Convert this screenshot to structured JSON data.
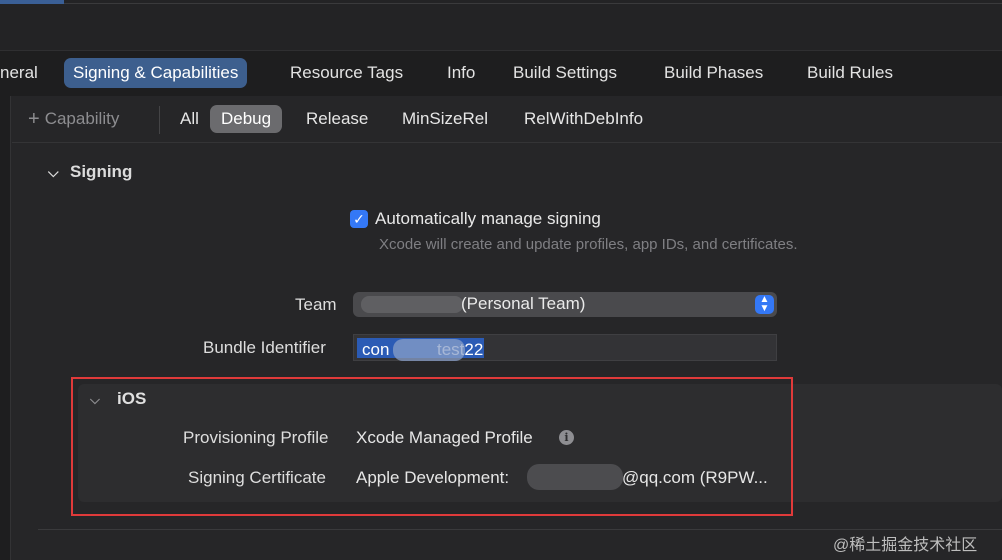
{
  "tabs": [
    {
      "label": "neral"
    },
    {
      "label": "Signing & Capabilities"
    },
    {
      "label": "Resource Tags"
    },
    {
      "label": "Info"
    },
    {
      "label": "Build Settings"
    },
    {
      "label": "Build Phases"
    },
    {
      "label": "Build Rules"
    }
  ],
  "toolbar": {
    "capability_label": "Capability",
    "configs": [
      "All",
      "Debug",
      "Release",
      "MinSizeRel",
      "RelWithDebInfo"
    ],
    "selected_config": "Debug"
  },
  "signing": {
    "title": "Signing",
    "auto_manage_label": "Automatically manage signing",
    "auto_manage_checked": true,
    "auto_manage_desc": "Xcode will create and update profiles, app IDs, and certificates.",
    "team_label": "Team",
    "team_value": "(Personal Team)",
    "bundle_label": "Bundle Identifier",
    "bundle_prefix": "con",
    "bundle_suffix": "test22"
  },
  "ios": {
    "title": "iOS",
    "profile_label": "Provisioning Profile",
    "profile_value": "Xcode Managed Profile",
    "cert_label": "Signing Certificate",
    "cert_prefix": "Apple Development:",
    "cert_suffix": "@qq.com (R9PW..."
  },
  "watermark": "@稀土掘金技术社区",
  "colors": {
    "accent": "#3d5f8e",
    "checkbox": "#3478f6",
    "annotation_box": "#e03a3a"
  },
  "icons": [
    "plus-icon",
    "chevron-down-icon",
    "checkmark-icon",
    "stepper-icon",
    "info-icon"
  ]
}
